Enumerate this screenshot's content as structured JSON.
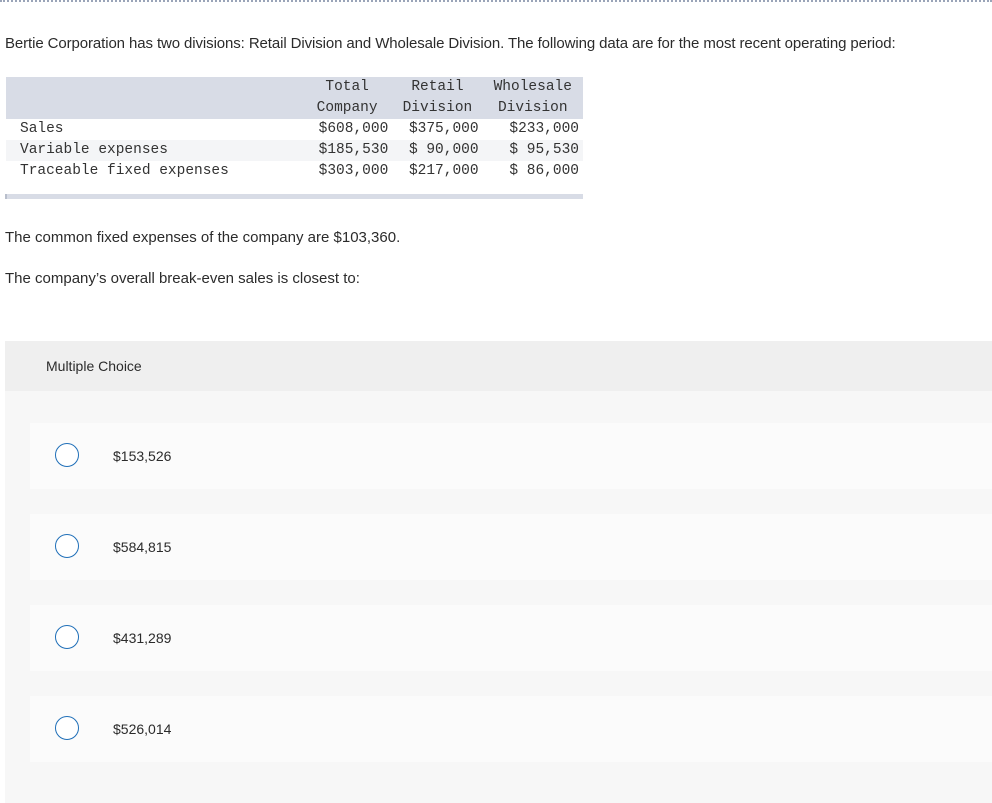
{
  "question": {
    "intro": "Bertie Corporation has two divisions: Retail Division and Wholesale Division. The following data are for the most recent operating period:",
    "common_fixed": "The common fixed expenses of the company are $103,360.",
    "prompt": "The company’s overall break-even sales is closest to:"
  },
  "table": {
    "headers_top": [
      "Total",
      "Retail",
      "Wholesale"
    ],
    "headers_bottom": [
      "Company",
      "Division",
      "Division"
    ],
    "rows": [
      {
        "label": "Sales",
        "values": [
          "$608,000",
          "$375,000",
          "$233,000"
        ]
      },
      {
        "label": "Variable expenses",
        "values": [
          "$185,530",
          "$ 90,000",
          "$ 95,530"
        ]
      },
      {
        "label": "Traceable fixed expenses",
        "values": [
          "$303,000",
          "$217,000",
          "$ 86,000"
        ]
      }
    ]
  },
  "multiple_choice": {
    "title": "Multiple Choice",
    "options": [
      {
        "label": "$153,526"
      },
      {
        "label": "$584,815"
      },
      {
        "label": "$431,289"
      },
      {
        "label": "$526,014"
      }
    ]
  }
}
